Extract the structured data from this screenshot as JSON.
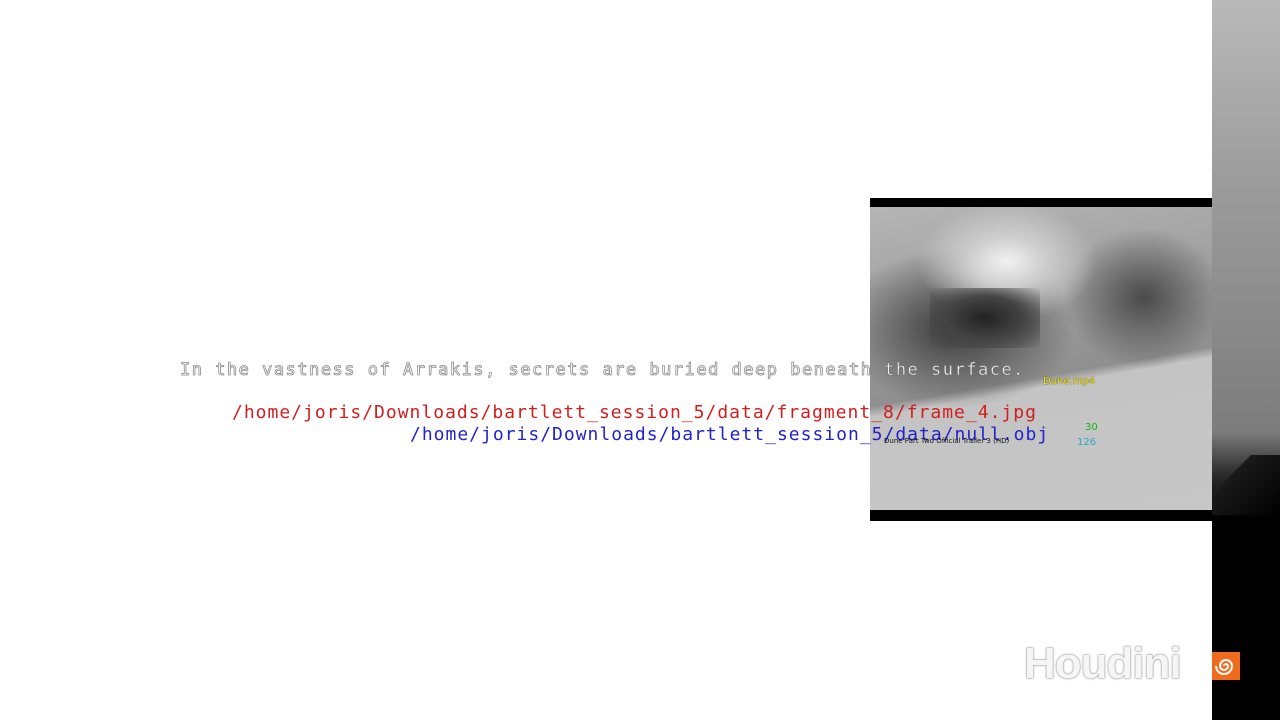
{
  "overlay": {
    "caption": "In the vastness of Arrakis, secrets are buried deep beneath the surface.",
    "fragment_path": "/home/joris/Downloads/bartlett_session_5/data/fragment_8/frame_4.jpg",
    "null_path": "/home/joris/Downloads/bartlett_session_5/data/null.obj"
  },
  "video": {
    "filename": "Dune.mp4",
    "title": "Dune Part Two Official Trailer 3 (HD)",
    "counter_top": "30",
    "counter_bottom": "126"
  },
  "logo": {
    "text": "Houdini",
    "icon": "houdini-swirl-icon",
    "icon_color": "#f26a1b"
  },
  "colors": {
    "fragment_path": "#d11e1e",
    "null_path": "#2323c8",
    "filename": "#f1e600",
    "counter_top": "#16b31a",
    "counter_bottom": "#2aa7c7"
  }
}
